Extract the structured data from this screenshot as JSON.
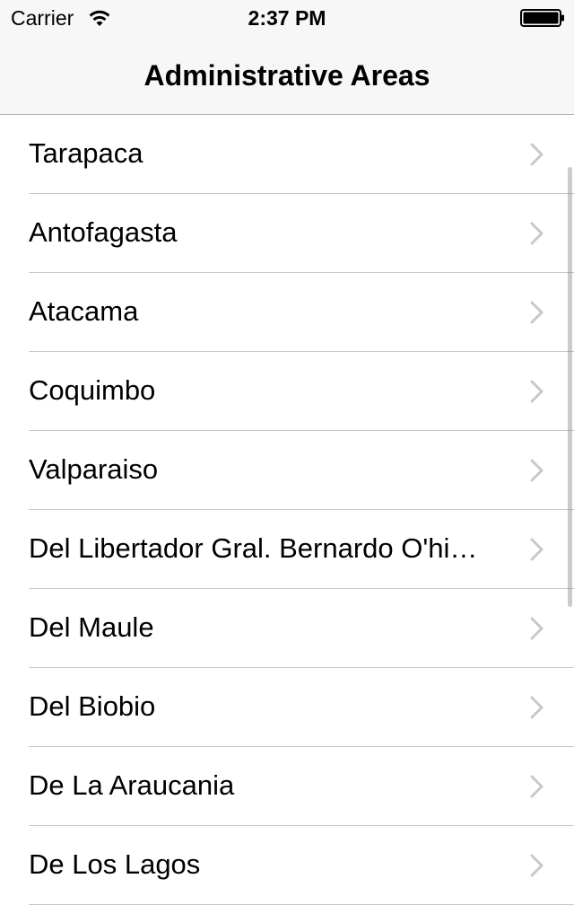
{
  "status_bar": {
    "carrier": "Carrier",
    "time": "2:37 PM"
  },
  "nav": {
    "title": "Administrative Areas"
  },
  "list": {
    "items": [
      "Tarapaca",
      "Antofagasta",
      "Atacama",
      "Coquimbo",
      "Valparaiso",
      "Del Libertador Gral. Bernardo O'hi…",
      "Del Maule",
      "Del Biobio",
      "De La Araucania",
      "De Los Lagos"
    ]
  },
  "colors": {
    "header_bg": "#f7f7f7",
    "separator": "#c8c7cc",
    "chevron": "#c7c7cc"
  },
  "icons": {
    "wifi": "wifi-icon",
    "battery": "battery-icon",
    "chevron": "chevron-right-icon"
  }
}
